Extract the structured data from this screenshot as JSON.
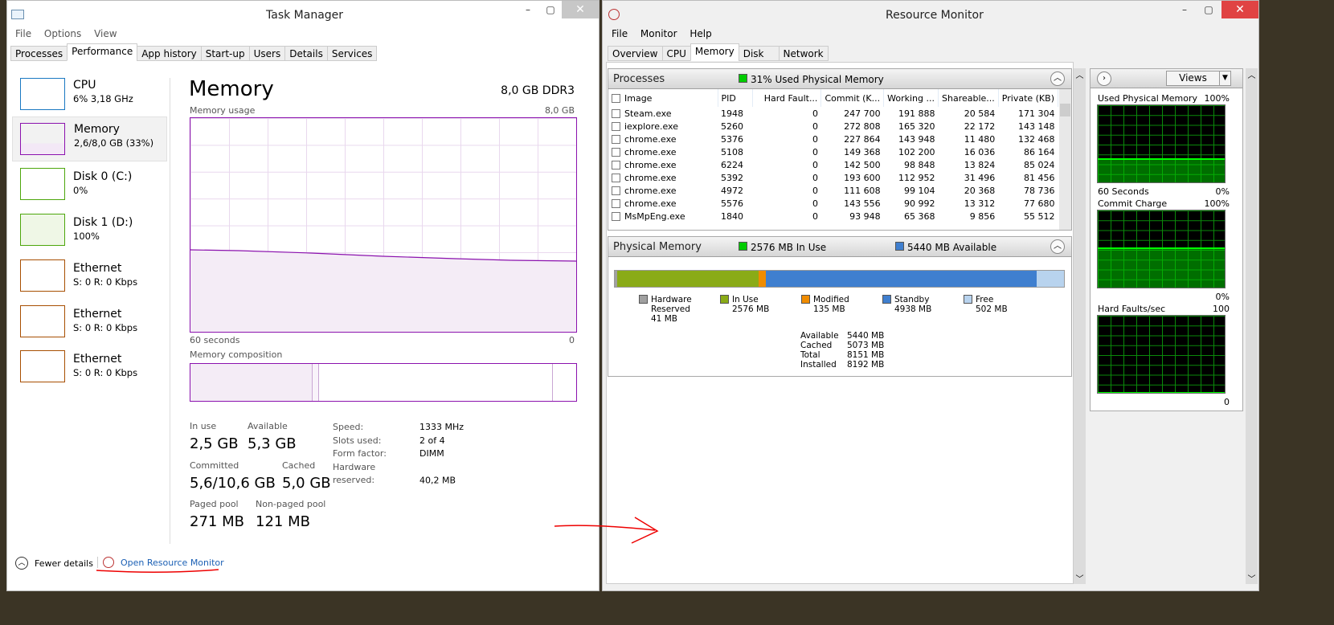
{
  "task_manager": {
    "title": "Task Manager",
    "menu": [
      "File",
      "Options",
      "View"
    ],
    "tabs": [
      "Processes",
      "Performance",
      "App history",
      "Start-up",
      "Users",
      "Details",
      "Services"
    ],
    "active_tab": "Performance",
    "sidebar": [
      {
        "name": "CPU",
        "sub": "6% 3,18 GHz"
      },
      {
        "name": "Memory",
        "sub": "2,6/8,0 GB (33%)"
      },
      {
        "name": "Disk 0 (C:)",
        "sub": "0%"
      },
      {
        "name": "Disk 1 (D:)",
        "sub": "100%"
      },
      {
        "name": "Ethernet",
        "sub": "S: 0 R: 0 Kbps"
      },
      {
        "name": "Ethernet",
        "sub": "S: 0 R: 0 Kbps"
      },
      {
        "name": "Ethernet",
        "sub": "S: 0 R: 0 Kbps"
      }
    ],
    "main": {
      "title": "Memory",
      "spec": "8,0 GB DDR3",
      "usage_label": "Memory usage",
      "usage_max": "8,0 GB",
      "x_left": "60 seconds",
      "x_right": "0",
      "composition_label": "Memory composition",
      "stats": {
        "in_use_label": "In use",
        "in_use": "2,5 GB",
        "available_label": "Available",
        "available": "5,3 GB",
        "committed_label": "Committed",
        "committed": "5,6/10,6 GB",
        "cached_label": "Cached",
        "cached": "5,0 GB",
        "paged_label": "Paged pool",
        "paged": "271 MB",
        "nonpaged_label": "Non-paged pool",
        "nonpaged": "121 MB"
      },
      "specs": [
        {
          "k": "Speed:",
          "v": "1333 MHz"
        },
        {
          "k": "Slots used:",
          "v": "2 of 4"
        },
        {
          "k": "Form factor:",
          "v": "DIMM"
        },
        {
          "k": "Hardware reserved:",
          "v": "40,2 MB"
        }
      ]
    },
    "footer": {
      "fewer": "Fewer details",
      "open_rm": "Open Resource Monitor"
    }
  },
  "resource_monitor": {
    "title": "Resource Monitor",
    "menu": [
      "File",
      "Monitor",
      "Help"
    ],
    "tabs": [
      "Overview",
      "CPU",
      "Memory",
      "Disk",
      "Network"
    ],
    "active_tab": "Memory",
    "processes": {
      "title": "Processes",
      "status": "31% Used Physical Memory",
      "columns": [
        "Image",
        "PID",
        "Hard Fault...",
        "Commit (K...",
        "Working ...",
        "Shareable...",
        "Private (KB)"
      ],
      "rows": [
        [
          "Steam.exe",
          "1948",
          "0",
          "247 700",
          "191 888",
          "20 584",
          "171 304"
        ],
        [
          "iexplore.exe",
          "5260",
          "0",
          "272 808",
          "165 320",
          "22 172",
          "143 148"
        ],
        [
          "chrome.exe",
          "5376",
          "0",
          "227 864",
          "143 948",
          "11 480",
          "132 468"
        ],
        [
          "chrome.exe",
          "5108",
          "0",
          "149 368",
          "102 200",
          "16 036",
          "86 164"
        ],
        [
          "chrome.exe",
          "6224",
          "0",
          "142 500",
          "98 848",
          "13 824",
          "85 024"
        ],
        [
          "chrome.exe",
          "5392",
          "0",
          "193 600",
          "112 952",
          "31 496",
          "81 456"
        ],
        [
          "chrome.exe",
          "4972",
          "0",
          "111 608",
          "99 104",
          "20 368",
          "78 736"
        ],
        [
          "chrome.exe",
          "5576",
          "0",
          "143 556",
          "90 992",
          "13 312",
          "77 680"
        ],
        [
          "MsMpEng.exe",
          "1840",
          "0",
          "93 948",
          "65 368",
          "9 856",
          "55 512"
        ]
      ]
    },
    "physical": {
      "title": "Physical Memory",
      "in_use": "2576 MB In Use",
      "available": "5440 MB Available",
      "legend": [
        {
          "name": "Hardware Reserved",
          "value": "41 MB",
          "color": "#a0a0a0"
        },
        {
          "name": "In Use",
          "value": "2576 MB",
          "color": "#8aab17"
        },
        {
          "name": "Modified",
          "value": "135 MB",
          "color": "#f08c00"
        },
        {
          "name": "Standby",
          "value": "4938 MB",
          "color": "#3f7fcf"
        },
        {
          "name": "Free",
          "value": "502 MB",
          "color": "#b8d3ee"
        }
      ],
      "details": [
        {
          "k": "Available",
          "v": "5440 MB"
        },
        {
          "k": "Cached",
          "v": "5073 MB"
        },
        {
          "k": "Total",
          "v": "8151 MB"
        },
        {
          "k": "Installed",
          "v": "8192 MB"
        }
      ]
    },
    "views_label": "Views",
    "graphs": [
      {
        "title": "Used Physical Memory",
        "top": "100%",
        "left": "60 Seconds",
        "bottom": "0%",
        "level": 0.31
      },
      {
        "title": "Commit Charge",
        "top": "100%",
        "bottom": "0%",
        "level": 0.52
      },
      {
        "title": "Hard Faults/sec",
        "top": "100",
        "bottom": "0",
        "level": 0.0
      }
    ]
  }
}
